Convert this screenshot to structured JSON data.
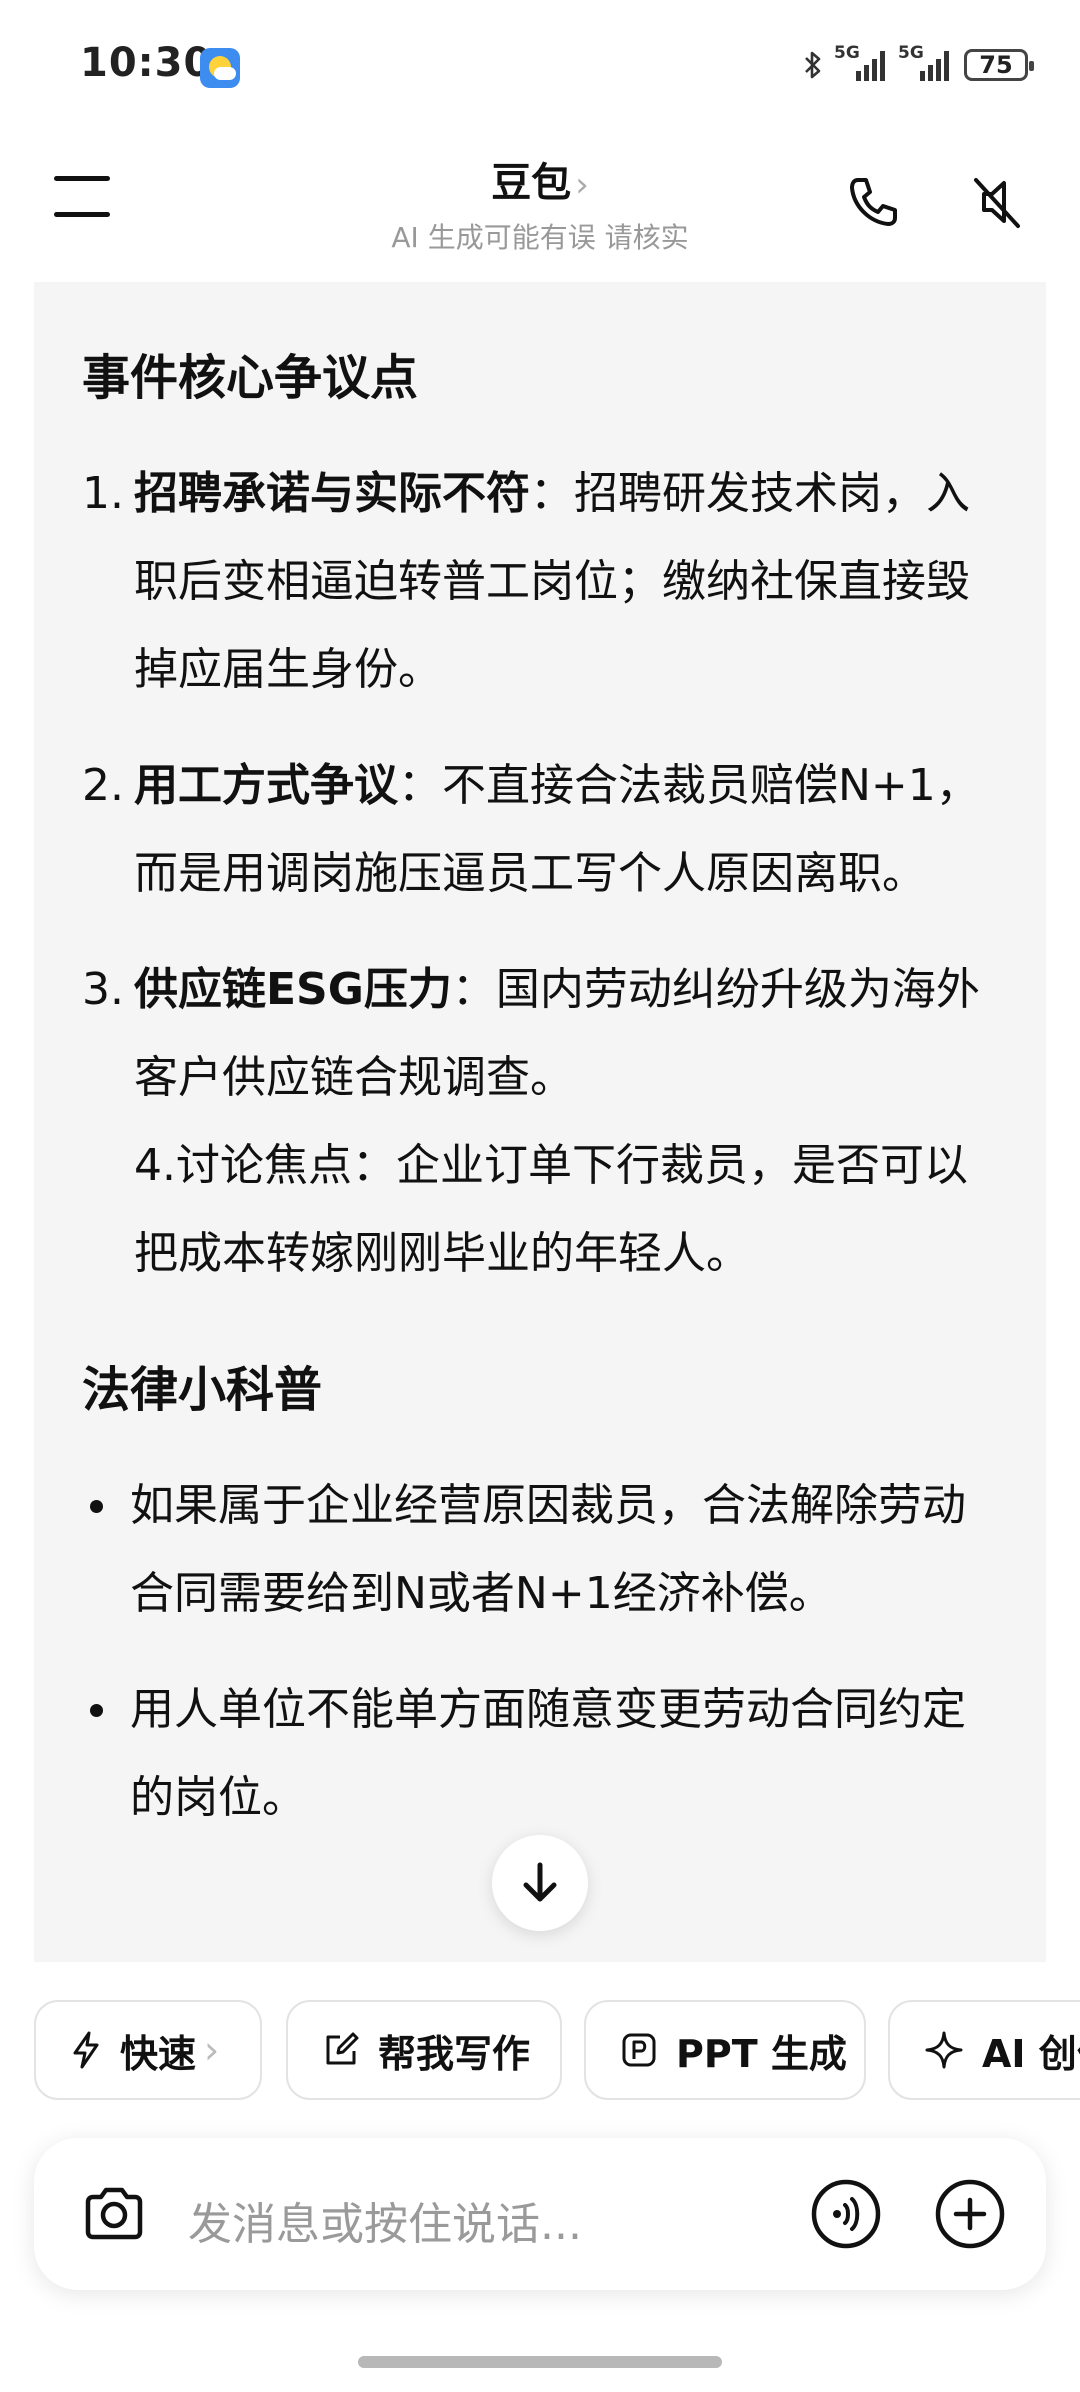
{
  "status_bar": {
    "time": "10:30",
    "network1": "5G",
    "network2": "5G",
    "battery": "75"
  },
  "header": {
    "title": "豆包",
    "title_chevron": "›",
    "subtitle": "AI 生成可能有误 请核实"
  },
  "message": {
    "section1_title": "事件核心争议点",
    "items": [
      {
        "num": "1.",
        "bold": "招聘承诺与实际不符",
        "text": "：招聘研发技术岗，入职后变相逼迫转普工岗位；缴纳社保直接毁掉应届生身份。"
      },
      {
        "num": "2.",
        "bold": "用工方式争议",
        "text": "：不直接合法裁员赔偿N+1，而是用调岗施压逼员工写个人原因离职。"
      },
      {
        "num": "3.",
        "bold": "供应链ESG压力",
        "text": "：国内劳动纠纷升级为海外客户供应链合规调查。"
      }
    ],
    "item4": "4.讨论焦点：企业订单下行裁员，是否可以把成本转嫁刚刚毕业的年轻人。",
    "section2_title": "法律小科普",
    "bullets": [
      "如果属于企业经营原因裁员，合法解除劳动合同需要给到N或者N+1经济补偿。",
      "用人单位不能单方面随意变更劳动合同约定的岗位。"
    ]
  },
  "chips": [
    {
      "label": "快速",
      "icon": "lightning-icon",
      "chevron": "›"
    },
    {
      "label": "帮我写作",
      "icon": "edit-icon"
    },
    {
      "label": "PPT 生成",
      "icon": "ppt-icon"
    },
    {
      "label": "AI 创作",
      "icon": "sparkle-icon"
    }
  ],
  "input": {
    "placeholder": "发消息或按住说话..."
  }
}
